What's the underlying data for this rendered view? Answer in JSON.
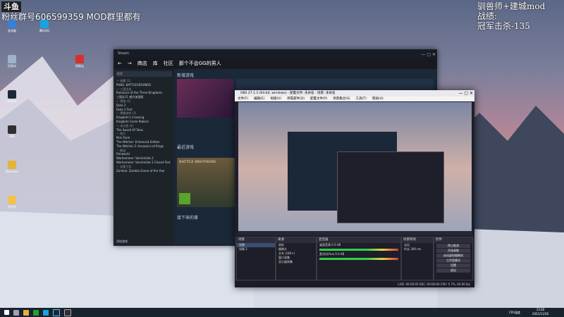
{
  "overlay": {
    "logo": "斗鱼",
    "fan_group": "粉丝群号606599359 MOD群里都有",
    "right_line1": "驯兽师+建城mod",
    "right_line2": "战绩:",
    "right_line3": "冠军击杀-135"
  },
  "desktop_icons": [
    {
      "label": "此电脑",
      "color": "#3b7dd8"
    },
    {
      "label": "回收站",
      "color": "#9fb2c8"
    },
    {
      "label": "Steam",
      "color": "#1b2838"
    },
    {
      "label": "OBS",
      "color": "#302e31"
    },
    {
      "label": "WeGame",
      "color": "#e3b33a"
    },
    {
      "label": "文件夹",
      "color": "#f2c14e"
    },
    {
      "label": "腾讯QQ",
      "color": "#1aa1e0"
    },
    {
      "label": "网易云",
      "color": "#d6302c"
    }
  ],
  "steam": {
    "window_title": "Steam",
    "nav_store": "商店",
    "nav_library": "库",
    "nav_community": "社区",
    "nav_user": "那个不会GG的男人",
    "search_placeholder": "搜索",
    "section_new": "新增游戏",
    "section_recent": "最近游戏",
    "section_download": "接下来的事",
    "featured_game": "BATTLE BROTHERS",
    "sidebar": [
      {
        "text": "— 收藏 (1)",
        "h": true
      },
      {
        "text": "PUBG: BATTLEGROUNDS",
        "h": false
      },
      {
        "text": "— 三国全战",
        "h": true
      },
      {
        "text": "Romance of the Three Kingdoms",
        "h": false
      },
      {
        "text": "三国志11 威力加强版",
        "h": false
      },
      {
        "text": "— 黑暗 (2)",
        "h": true
      },
      {
        "text": "Dota 2",
        "h": false
      },
      {
        "text": "Dota 2 Test",
        "h": false
      },
      {
        "text": "— 策略游戏 (3)",
        "h": true
      },
      {
        "text": "Kingdom's Crossing",
        "h": false
      },
      {
        "text": "Kingdom Come Reborn",
        "h": false
      },
      {
        "text": "— 未分类 (4)",
        "h": true
      },
      {
        "text": "The Sword Of Tales",
        "h": false
      },
      {
        "text": "— 独立",
        "h": true
      },
      {
        "text": "Mini Farm",
        "h": false
      },
      {
        "text": "The Witcher: Enhanced Edition",
        "h": false
      },
      {
        "text": "The Witcher 2: Assassins of Kings",
        "h": false
      },
      {
        "text": "— 解谜",
        "h": true
      },
      {
        "text": "Rimworld",
        "h": false
      },
      {
        "text": "Warhammer: Vermintide 2",
        "h": false
      },
      {
        "text": "Warhammer: Vermintide 2 Closed Test",
        "h": false
      },
      {
        "text": "— 创意工坊",
        "h": true
      },
      {
        "text": "Zombie: Zombie Game of the Year",
        "h": false
      }
    ],
    "add_game": "添加游戏"
  },
  "obs": {
    "title": "OBS 27.1.3 (64-bit, windows) - 配置文件: 未命名 - 场景: 未命名",
    "menu": [
      "文件(F)",
      "编辑(E)",
      "视图(V)",
      "停靠部件(D)",
      "配置文件(P)",
      "场景集合(S)",
      "工具(T)",
      "帮助(H)"
    ],
    "scenes_header": "场景",
    "scenes": [
      "场景",
      "场景 2"
    ],
    "sources_header": "来源",
    "sources": [
      "鼠标",
      "摄像头",
      "文本 (GDI+)",
      "窗口采集",
      "显示器采集"
    ],
    "mixer_header": "混音器",
    "mixer": [
      {
        "name": "桌面音频",
        "db": "0.0 dB"
      },
      {
        "name": "麦克风/Aux",
        "db": "0.0 dB"
      }
    ],
    "transitions_header": "场景转场",
    "transition_type": "淡出",
    "duration_label": "时长",
    "duration": "300 ms",
    "controls_header": "控件",
    "controls": [
      "停止推流",
      "开始录制",
      "启动虚拟摄像机",
      "工作室模式",
      "设置",
      "退出"
    ],
    "status": "LIVE: 00:56:05   REC: 00:00:00   CPU: 5.7%, 60.00 fps"
  },
  "taskbar": {
    "time": "13:40",
    "date": "2021/11/26",
    "tray": "CPU温度"
  }
}
